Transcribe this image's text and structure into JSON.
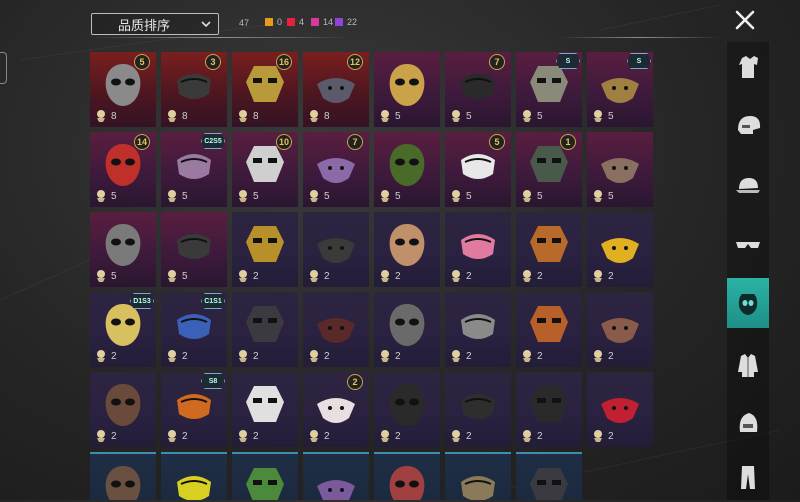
{
  "sort_dropdown": {
    "label": "品质排序"
  },
  "stats": {
    "total": "47",
    "counts": [
      {
        "color": "#e89a1c",
        "value": "0"
      },
      {
        "color": "#e8203a",
        "value": "4"
      },
      {
        "color": "#d73a9a",
        "value": "14"
      },
      {
        "color": "#8e44d6",
        "value": "22"
      }
    ]
  },
  "close_label": "close",
  "sidebar": {
    "items": [
      {
        "icon": "outfit-icon",
        "active": false
      },
      {
        "icon": "helmet-icon",
        "active": false
      },
      {
        "icon": "cap-icon",
        "active": false
      },
      {
        "icon": "glasses-icon",
        "active": false
      },
      {
        "icon": "mask-icon",
        "active": true
      },
      {
        "icon": "jacket-icon",
        "active": false
      },
      {
        "icon": "tactical-helmet-icon",
        "active": false
      },
      {
        "icon": "pants-icon",
        "active": false
      }
    ]
  },
  "grid": {
    "items": [
      {
        "name": "plague-doctor-mask",
        "rarity": "red",
        "badge": "5",
        "count": "8",
        "color": "#8a8a8a"
      },
      {
        "name": "gorilla-mask",
        "rarity": "red",
        "badge": "3",
        "count": "8",
        "color": "#3a3a3a"
      },
      {
        "name": "gold-skull-mask",
        "rarity": "red",
        "badge": "16",
        "count": "8",
        "color": "#b89a3a"
      },
      {
        "name": "knight-visor-mask",
        "rarity": "red",
        "badge": "12",
        "count": "8",
        "color": "#5a5a6a"
      },
      {
        "name": "duck-mask",
        "rarity": "pink",
        "badge": "",
        "count": "5",
        "color": "#c9a24a"
      },
      {
        "name": "dark-visor",
        "rarity": "pink",
        "badge": "7",
        "count": "5",
        "color": "#2a2a2a"
      },
      {
        "name": "gas-mask-wheat",
        "rarity": "pink",
        "hex": "S",
        "count": "5",
        "color": "#8a8a7a"
      },
      {
        "name": "gold-tribal-mask",
        "rarity": "pink",
        "hex": "S",
        "count": "5",
        "color": "#a08040"
      },
      {
        "name": "oni-red-mask",
        "rarity": "pink",
        "badge": "14",
        "count": "5",
        "color": "#c0302a"
      },
      {
        "name": "bandana-neon",
        "rarity": "pink",
        "hex": "C2S5",
        "count": "5",
        "color": "#9a7aa0"
      },
      {
        "name": "white-respirator",
        "rarity": "pink",
        "badge": "10",
        "count": "5",
        "color": "#cfcfcf"
      },
      {
        "name": "purple-gold-mask",
        "rarity": "pink",
        "badge": "7",
        "count": "5",
        "color": "#8a6aa8"
      },
      {
        "name": "green-hood-mask",
        "rarity": "pink",
        "badge": "",
        "count": "5",
        "color": "#4a6a2a"
      },
      {
        "name": "clown-mask-red",
        "rarity": "pink",
        "badge": "5",
        "count": "5",
        "color": "#e8e8e8"
      },
      {
        "name": "gas-mask-green",
        "rarity": "pink",
        "badge": "1",
        "count": "5",
        "color": "#4a5a4a"
      },
      {
        "name": "beast-skull-mask",
        "rarity": "pink",
        "badge": "",
        "count": "5",
        "color": "#8a7060"
      },
      {
        "name": "grey-skull-mask",
        "rarity": "pink",
        "badge": "",
        "count": "5",
        "color": "#7a7a7a"
      },
      {
        "name": "black-wrap-mask",
        "rarity": "pink",
        "badge": "",
        "count": "5",
        "color": "#3a3a3a"
      },
      {
        "name": "gold-mask",
        "rarity": "purple",
        "badge": "",
        "count": "2",
        "color": "#b8902a"
      },
      {
        "name": "black-half-mask",
        "rarity": "purple",
        "badge": "",
        "count": "2",
        "color": "#3a3a3a"
      },
      {
        "name": "mammoth-mask",
        "rarity": "purple",
        "badge": "",
        "count": "2",
        "color": "#c0906a"
      },
      {
        "name": "pink-pig-mask",
        "rarity": "purple",
        "badge": "",
        "count": "2",
        "color": "#e07aa0"
      },
      {
        "name": "orange-goggle-mask",
        "rarity": "purple",
        "badge": "",
        "count": "2",
        "color": "#b86a2a"
      },
      {
        "name": "robot-yellow-mask",
        "rarity": "purple",
        "badge": "",
        "count": "2",
        "color": "#e0b020"
      },
      {
        "name": "clover-bandana",
        "rarity": "purple",
        "hex": "D1S3",
        "count": "2",
        "color": "#d8c060"
      },
      {
        "name": "blue-bandana",
        "rarity": "purple",
        "hex": "C1S1",
        "count": "2",
        "color": "#3a60b8"
      },
      {
        "name": "black-cloth-mask",
        "rarity": "purple",
        "badge": "",
        "count": "2",
        "color": "#3a3a40"
      },
      {
        "name": "black-red-mask",
        "rarity": "purple",
        "badge": "",
        "count": "2",
        "color": "#5a2a2a"
      },
      {
        "name": "grey-hood-mask",
        "rarity": "purple",
        "badge": "",
        "count": "2",
        "color": "#6a6a6a"
      },
      {
        "name": "silver-hood-mask",
        "rarity": "purple",
        "badge": "",
        "count": "2",
        "color": "#8a8a8a"
      },
      {
        "name": "orange-wrap-mask",
        "rarity": "purple",
        "badge": "",
        "count": "2",
        "color": "#b8602a"
      },
      {
        "name": "brown-face-mask",
        "rarity": "purple",
        "badge": "",
        "count": "2",
        "color": "#8a5a4a"
      },
      {
        "name": "brown-bandana",
        "rarity": "purple",
        "badge": "",
        "count": "2",
        "color": "#6a4a3a"
      },
      {
        "name": "flame-bandana",
        "rarity": "purple",
        "hex": "S8",
        "count": "2",
        "color": "#d06a20"
      },
      {
        "name": "teeth-bandana",
        "rarity": "purple",
        "badge": "",
        "count": "2",
        "color": "#e0e0e0"
      },
      {
        "name": "clown-mask",
        "rarity": "purple",
        "badge": "2",
        "count": "2",
        "color": "#e8e0e0"
      },
      {
        "name": "black-skull-mask",
        "rarity": "purple",
        "badge": "",
        "count": "2",
        "color": "#2a2a2a"
      },
      {
        "name": "black-face-mask",
        "rarity": "purple",
        "badge": "",
        "count": "2",
        "color": "#2e2e2e"
      },
      {
        "name": "black-bandana",
        "rarity": "purple",
        "badge": "",
        "count": "2",
        "color": "#2a2a2a"
      },
      {
        "name": "red-scarf",
        "rarity": "purple",
        "badge": "",
        "count": "2",
        "color": "#c02030"
      },
      {
        "name": "brown-cap-mask",
        "rarity": "blue",
        "badge": "",
        "count": "",
        "color": "#6a5040"
      },
      {
        "name": "yellow-mesh-mask",
        "rarity": "blue",
        "badge": "",
        "count": "",
        "color": "#d8d020"
      },
      {
        "name": "green-mesh-mask",
        "rarity": "blue",
        "badge": "",
        "count": "",
        "color": "#4a8a3a"
      },
      {
        "name": "purple-domino-mask",
        "rarity": "blue",
        "badge": "",
        "count": "",
        "color": "#7a5a9a"
      },
      {
        "name": "red-domino-mask",
        "rarity": "blue",
        "badge": "",
        "count": "",
        "color": "#a04040"
      },
      {
        "name": "tan-mask",
        "rarity": "blue",
        "badge": "",
        "count": "",
        "color": "#8a7a5a"
      },
      {
        "name": "dark-mask",
        "rarity": "blue",
        "badge": "",
        "count": "",
        "color": "#3a3a40"
      }
    ]
  }
}
